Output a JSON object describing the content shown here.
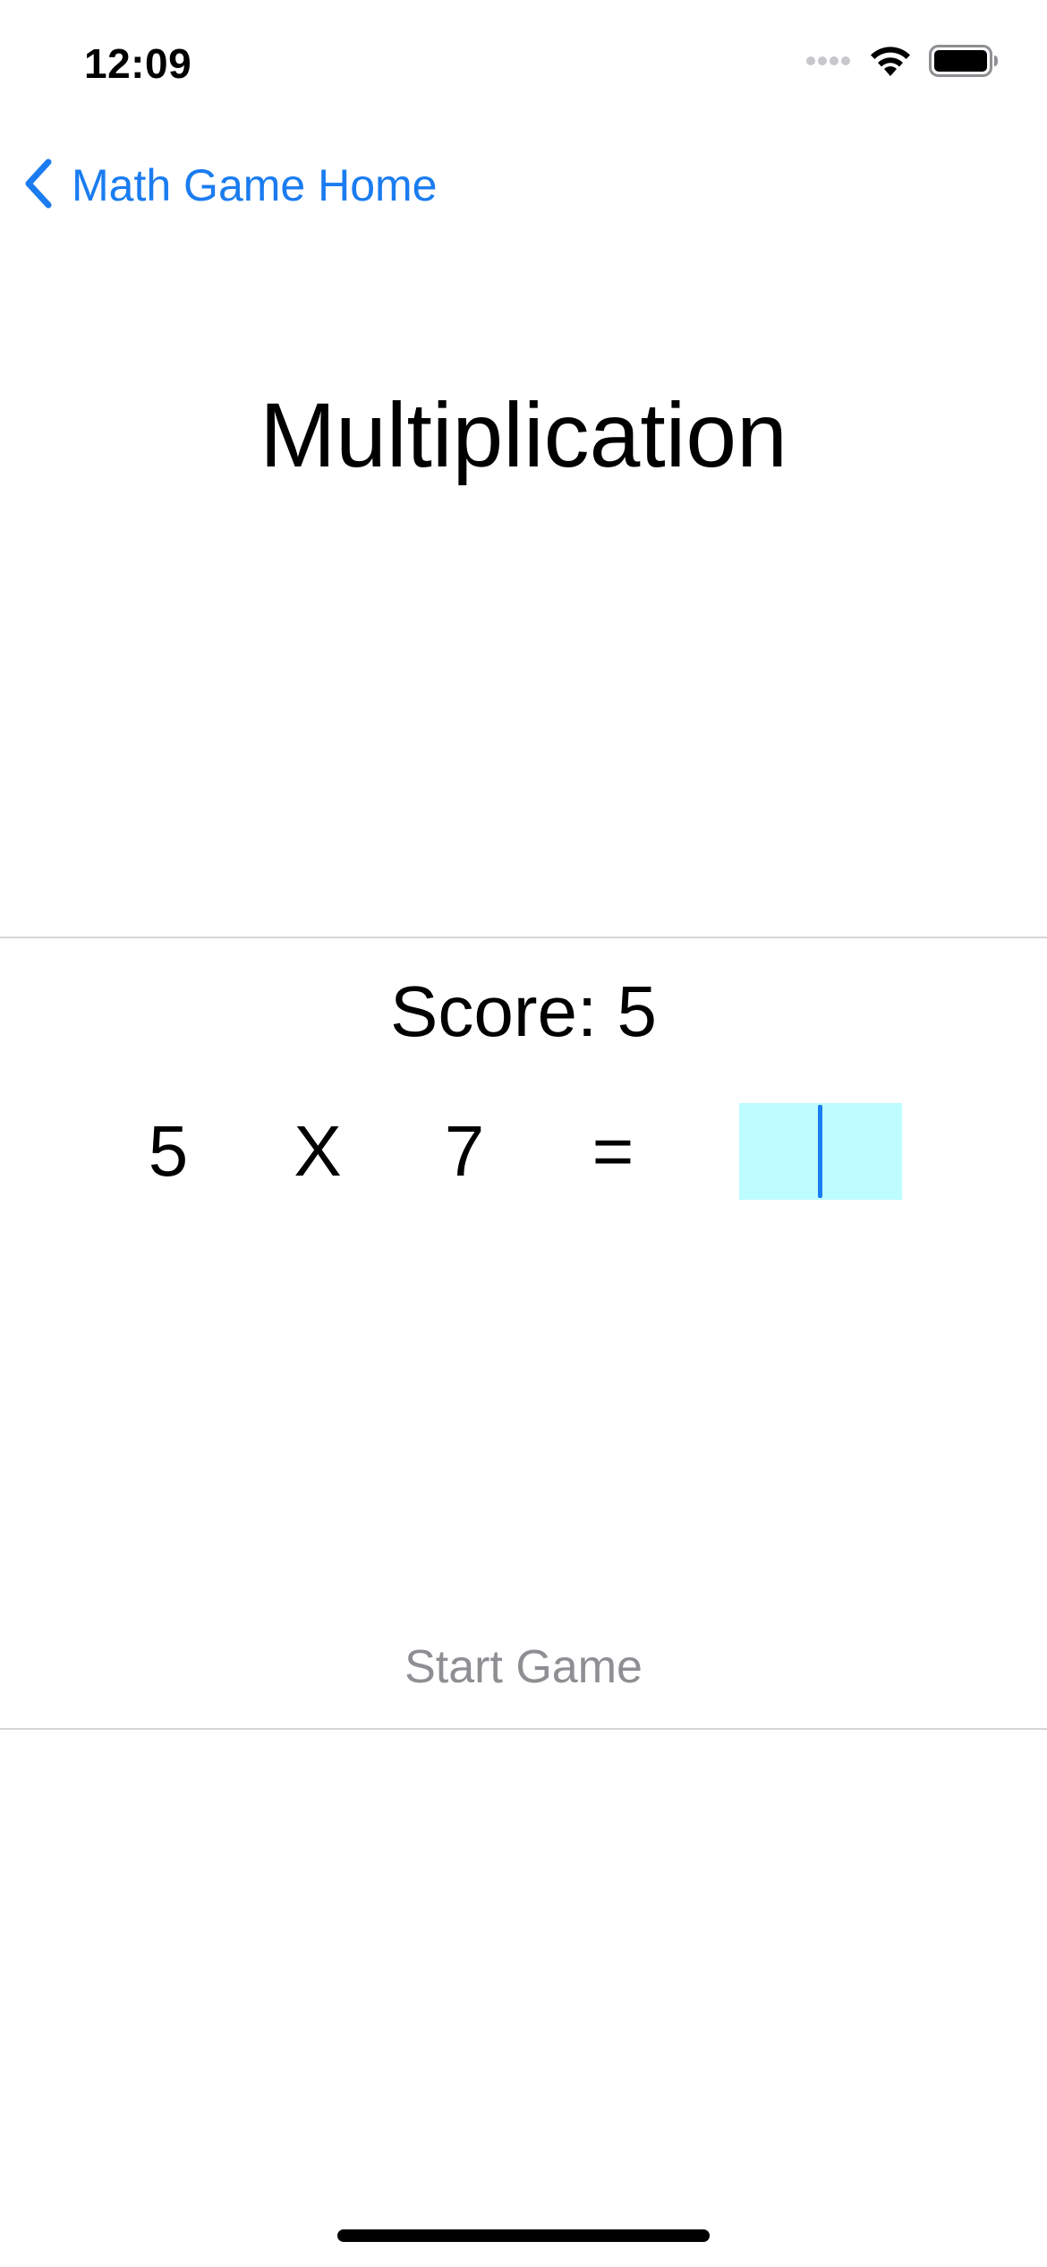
{
  "status_bar": {
    "time": "12:09",
    "signal_icon": "cellular-signal-icon",
    "wifi_icon": "wifi-icon",
    "battery_icon": "battery-icon"
  },
  "nav": {
    "back_label": "Math Game Home",
    "back_icon": "chevron-left-icon",
    "accent_color": "#1a7cf0"
  },
  "title": "Multiplication",
  "game": {
    "score_text": "Score: 5",
    "operand_a": "5",
    "operator": "X",
    "operand_b": "7",
    "equals": "=",
    "answer_value": "",
    "answer_field_color": "#bdfcff"
  },
  "start_button_label": "Start Game"
}
